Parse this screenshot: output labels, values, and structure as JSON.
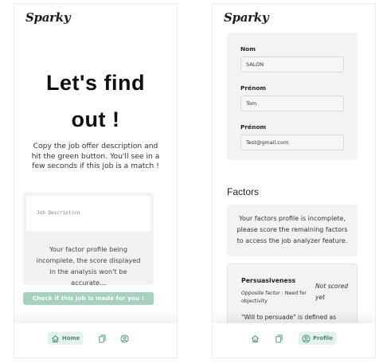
{
  "app": {
    "logo": "Sparky"
  },
  "home_screen": {
    "hero_title_line1": "Let's find",
    "hero_title_line2": "out !",
    "description": "Copy the job offer description and hit the green button. You'll see in a few seconds if this job is a match !",
    "job_description_placeholder": "Job Description",
    "warning": "Your factor profile being incomplete, the score displayed in the analysis won't be accurate...",
    "check_button": "Check if this job is made for you !"
  },
  "nav": {
    "home_label": "Home",
    "profile_label": "Profile",
    "icons": [
      "home-icon",
      "documents-icon",
      "profile-icon"
    ],
    "accent_color": "#4a8b72",
    "active_bg": "#e5f2ec"
  },
  "profile_screen": {
    "fields": [
      {
        "label": "Nom",
        "value": "SALON"
      },
      {
        "label": "Prénom",
        "value": "Tom"
      },
      {
        "label": "Prénom",
        "value": "Test@gmail.com"
      }
    ],
    "factors_title": "Factors",
    "incomplete_notice": "Your factors profile is incomplete, please score the remaining factors to access the job analyzer feature.",
    "factor": {
      "name": "Persuasiveness",
      "opposite_label": "Opposite factor",
      "opposite_value": " : Need for objectivity",
      "status": "Not scored yet",
      "description": "\"Will to persuade\" is defined as"
    }
  },
  "colors": {
    "check_button": "#a6d1bf",
    "card_bg": "#f3f3f3"
  }
}
